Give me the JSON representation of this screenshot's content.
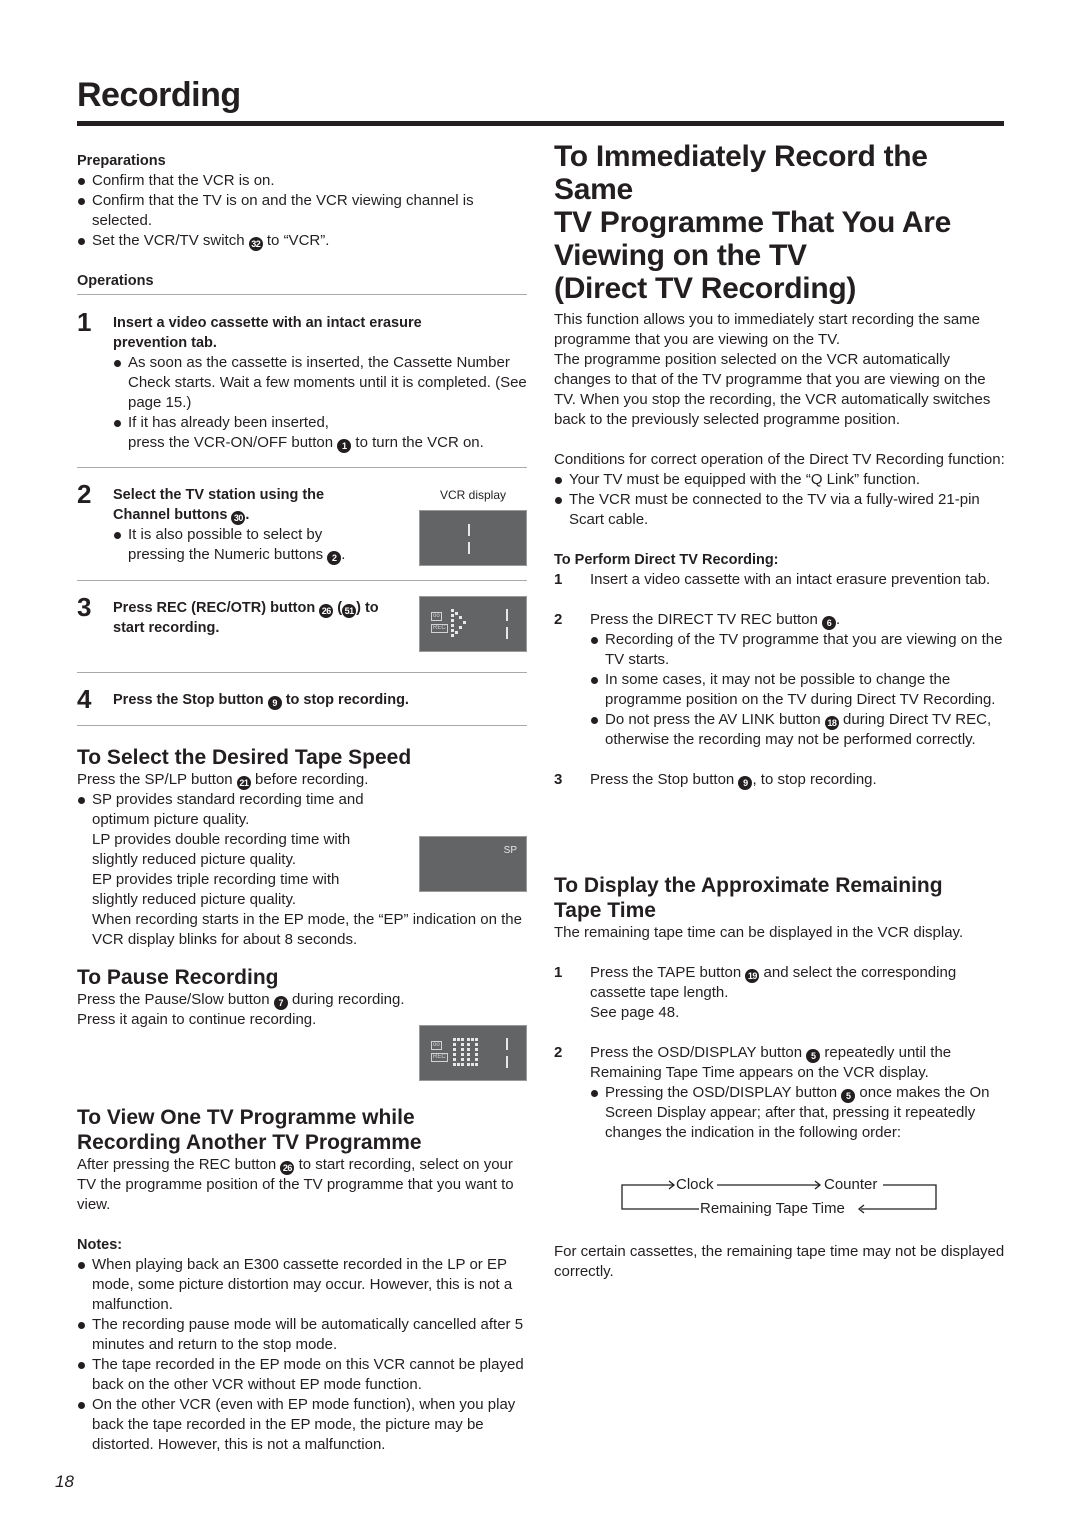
{
  "page": {
    "title": "Recording",
    "page_number": "18"
  },
  "left": {
    "preparations": {
      "heading": "Preparations",
      "items": [
        "Confirm that the VCR is on.",
        "Confirm that the TV is on and the VCR viewing channel is selected.",
        {
          "before": "Set the VCR/TV switch ",
          "ref": "32",
          "after": " to “VCR”."
        }
      ]
    },
    "operations": {
      "heading": "Operations",
      "steps": [
        {
          "num": "1",
          "title": "Insert a video cassette with an intact erasure prevention tab.",
          "bullets": [
            "As soon as the cassette is inserted, the Cassette Number Check starts. Wait a few moments until it is completed. (See page 15.)",
            {
              "line1": "If it has already been inserted,",
              "before": "press the VCR-ON/OFF button ",
              "ref": "1",
              "after": " to turn the VCR on."
            }
          ]
        },
        {
          "num": "2",
          "title_before": "Select the TV station using the Channel buttons ",
          "title_ref": "30",
          "title_after": ".",
          "bullet_before": "It is also possible to select by pressing the Numeric buttons ",
          "bullet_ref": "2",
          "bullet_after": ".",
          "display_label": "VCR display"
        },
        {
          "num": "3",
          "title_before": "Press REC (REC/OTR) button ",
          "title_ref": "26",
          "title_mid": " (",
          "title_ref2": "51",
          "title_after": ") to start recording.",
          "display_icons": [
            "οο",
            "REC"
          ]
        },
        {
          "num": "4",
          "title_before": "Press the Stop button ",
          "title_ref": "9",
          "title_after": " to stop recording."
        }
      ]
    },
    "tape_speed": {
      "heading": "To Select the Desired Tape Speed",
      "intro_before": "Press the SP/LP button ",
      "intro_ref": "21",
      "intro_after": " before recording.",
      "bullet": "SP provides standard recording time and optimum picture quality.",
      "lp": "LP provides double recording time with slightly reduced picture quality.",
      "ep": "EP provides triple recording time with slightly reduced picture quality.",
      "ep_note": "When recording starts in the EP mode, the “EP” indication on the VCR display blinks for about 8 seconds.",
      "display_text": "SP"
    },
    "pause": {
      "heading": "To Pause Recording",
      "line1_before": "Press the Pause/Slow button ",
      "line1_ref": "7",
      "line1_after": " during recording.",
      "line2": "Press it again to continue recording."
    },
    "view_other": {
      "heading": "To View One TV Programme while Recording Another TV Programme",
      "text_before": "After pressing the REC button ",
      "text_ref": "26",
      "text_after": " to start recording, select on your TV the programme position of the TV programme that you want to view."
    },
    "notes": {
      "heading": "Notes:",
      "items": [
        "When playing back an E300 cassette recorded in the LP or EP mode, some picture distortion may occur. However, this is not a malfunction.",
        "The recording pause mode will be automatically cancelled after 5 minutes and return to the stop mode.",
        "The tape recorded in the EP mode on this VCR cannot be played back on the other VCR without EP mode function.",
        "On the other VCR (even with EP mode function), when you play back the tape recorded in the EP mode, the picture may be distorted. However, this is not a malfunction."
      ]
    }
  },
  "right": {
    "direct_tv": {
      "heading_lines": [
        "To Immediately Record the Same",
        "TV Programme That You Are",
        "Viewing on the TV",
        "(Direct TV Recording)"
      ],
      "intro": "This function allows you to immediately start recording the same programme that you are viewing on the TV.",
      "intro2": "The programme position selected on the VCR automatically changes to that of the TV programme that you are viewing on the TV. When you stop the recording, the VCR automatically switches back to the previously selected programme position.",
      "conditions": "Conditions for correct operation of the Direct TV Recording function:",
      "condition_items": [
        "Your TV must be equipped with the “Q Link” function.",
        "The VCR must be connected to the TV via a fully-wired 21-pin Scart cable."
      ],
      "perform_heading": "To Perform Direct TV Recording:",
      "steps": [
        {
          "num": "1",
          "text": "Insert a video cassette with an intact erasure prevention tab."
        },
        {
          "num": "2",
          "before": "Press the DIRECT TV REC button ",
          "ref": "6",
          "after": "."
        },
        {
          "num": "3",
          "before": "Press the Stop button ",
          "ref": "9",
          "after": ", to stop recording."
        }
      ],
      "step2_bullets": [
        "Recording of the TV programme that you are viewing on the TV starts.",
        "In some cases, it may not be possible to change the programme position on the TV during Direct TV Recording.",
        {
          "before": "Do not press the AV LINK button ",
          "ref": "18",
          "after": " during Direct TV REC, otherwise the recording may not be performed correctly."
        }
      ]
    },
    "remaining": {
      "heading": "To Display the Approximate Remaining Tape Time",
      "intro": "The remaining tape time can be displayed in the VCR display.",
      "step1": {
        "num": "1",
        "before": "Press the TAPE button ",
        "ref": "19",
        "after": " and select the corresponding cassette tape length.",
        "see": "See page 48."
      },
      "step2": {
        "num": "2",
        "before": "Press the OSD/DISPLAY button ",
        "ref": "5",
        "after": " repeatedly until the Remaining Tape Time appears on the VCR display."
      },
      "step2_bullet": {
        "before": "Pressing the OSD/DISPLAY button ",
        "ref": "5",
        "after": " once makes the On Screen Display appear; after that, pressing it repeatedly changes the indication in the following order:"
      },
      "flow": [
        "Clock",
        "Counter",
        "Remaining Tape Time"
      ],
      "footer": "For certain cassettes, the remaining tape time may not be displayed correctly."
    }
  }
}
